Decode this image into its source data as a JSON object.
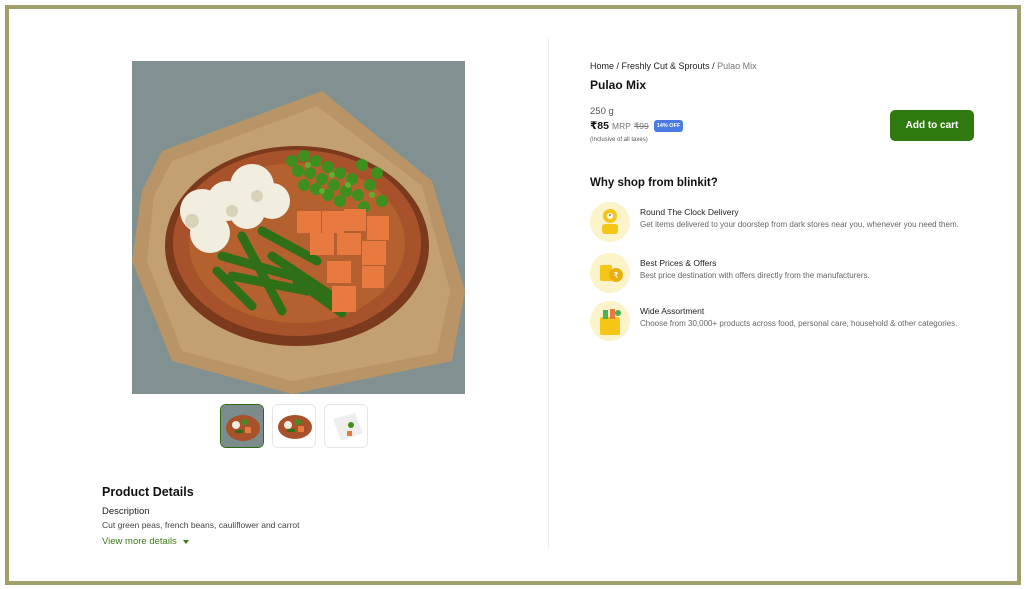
{
  "product": {
    "title": "Pulao Mix",
    "weight": "250 g",
    "price": "₹85",
    "mrp_label": "MRP",
    "mrp_value": "₹99",
    "discount": "14% OFF",
    "taxes_note": "(Inclusive of all taxes)",
    "add_to_cart": "Add to cart"
  },
  "breadcrumb": {
    "home": "Home",
    "sep": " / ",
    "category": "Freshly Cut & Sprouts",
    "current": "Pulao Mix"
  },
  "details": {
    "title": "Product Details",
    "description_label": "Description",
    "description": "Cut green peas, french beans, cauliflower and carrot",
    "more_link": "View more details"
  },
  "why": {
    "title": "Why shop from blinkit?",
    "features": [
      {
        "icon": "delivery-clock-icon",
        "title": "Round The Clock Delivery",
        "desc": "Get items delivered to your doorstep from dark stores near you, whenever you need them."
      },
      {
        "icon": "best-price-icon",
        "title": "Best Prices & Offers",
        "desc": "Best price destination with offers directly from the manufacturers."
      },
      {
        "icon": "assortment-bag-icon",
        "title": "Wide Assortment",
        "desc": "Choose from 30,000+ products across food, personal care, household & other categories."
      }
    ]
  },
  "colors": {
    "brand_green": "#2f7a0f",
    "discount_blue": "#4a7be5",
    "frame_olive": "#a19f6a"
  }
}
